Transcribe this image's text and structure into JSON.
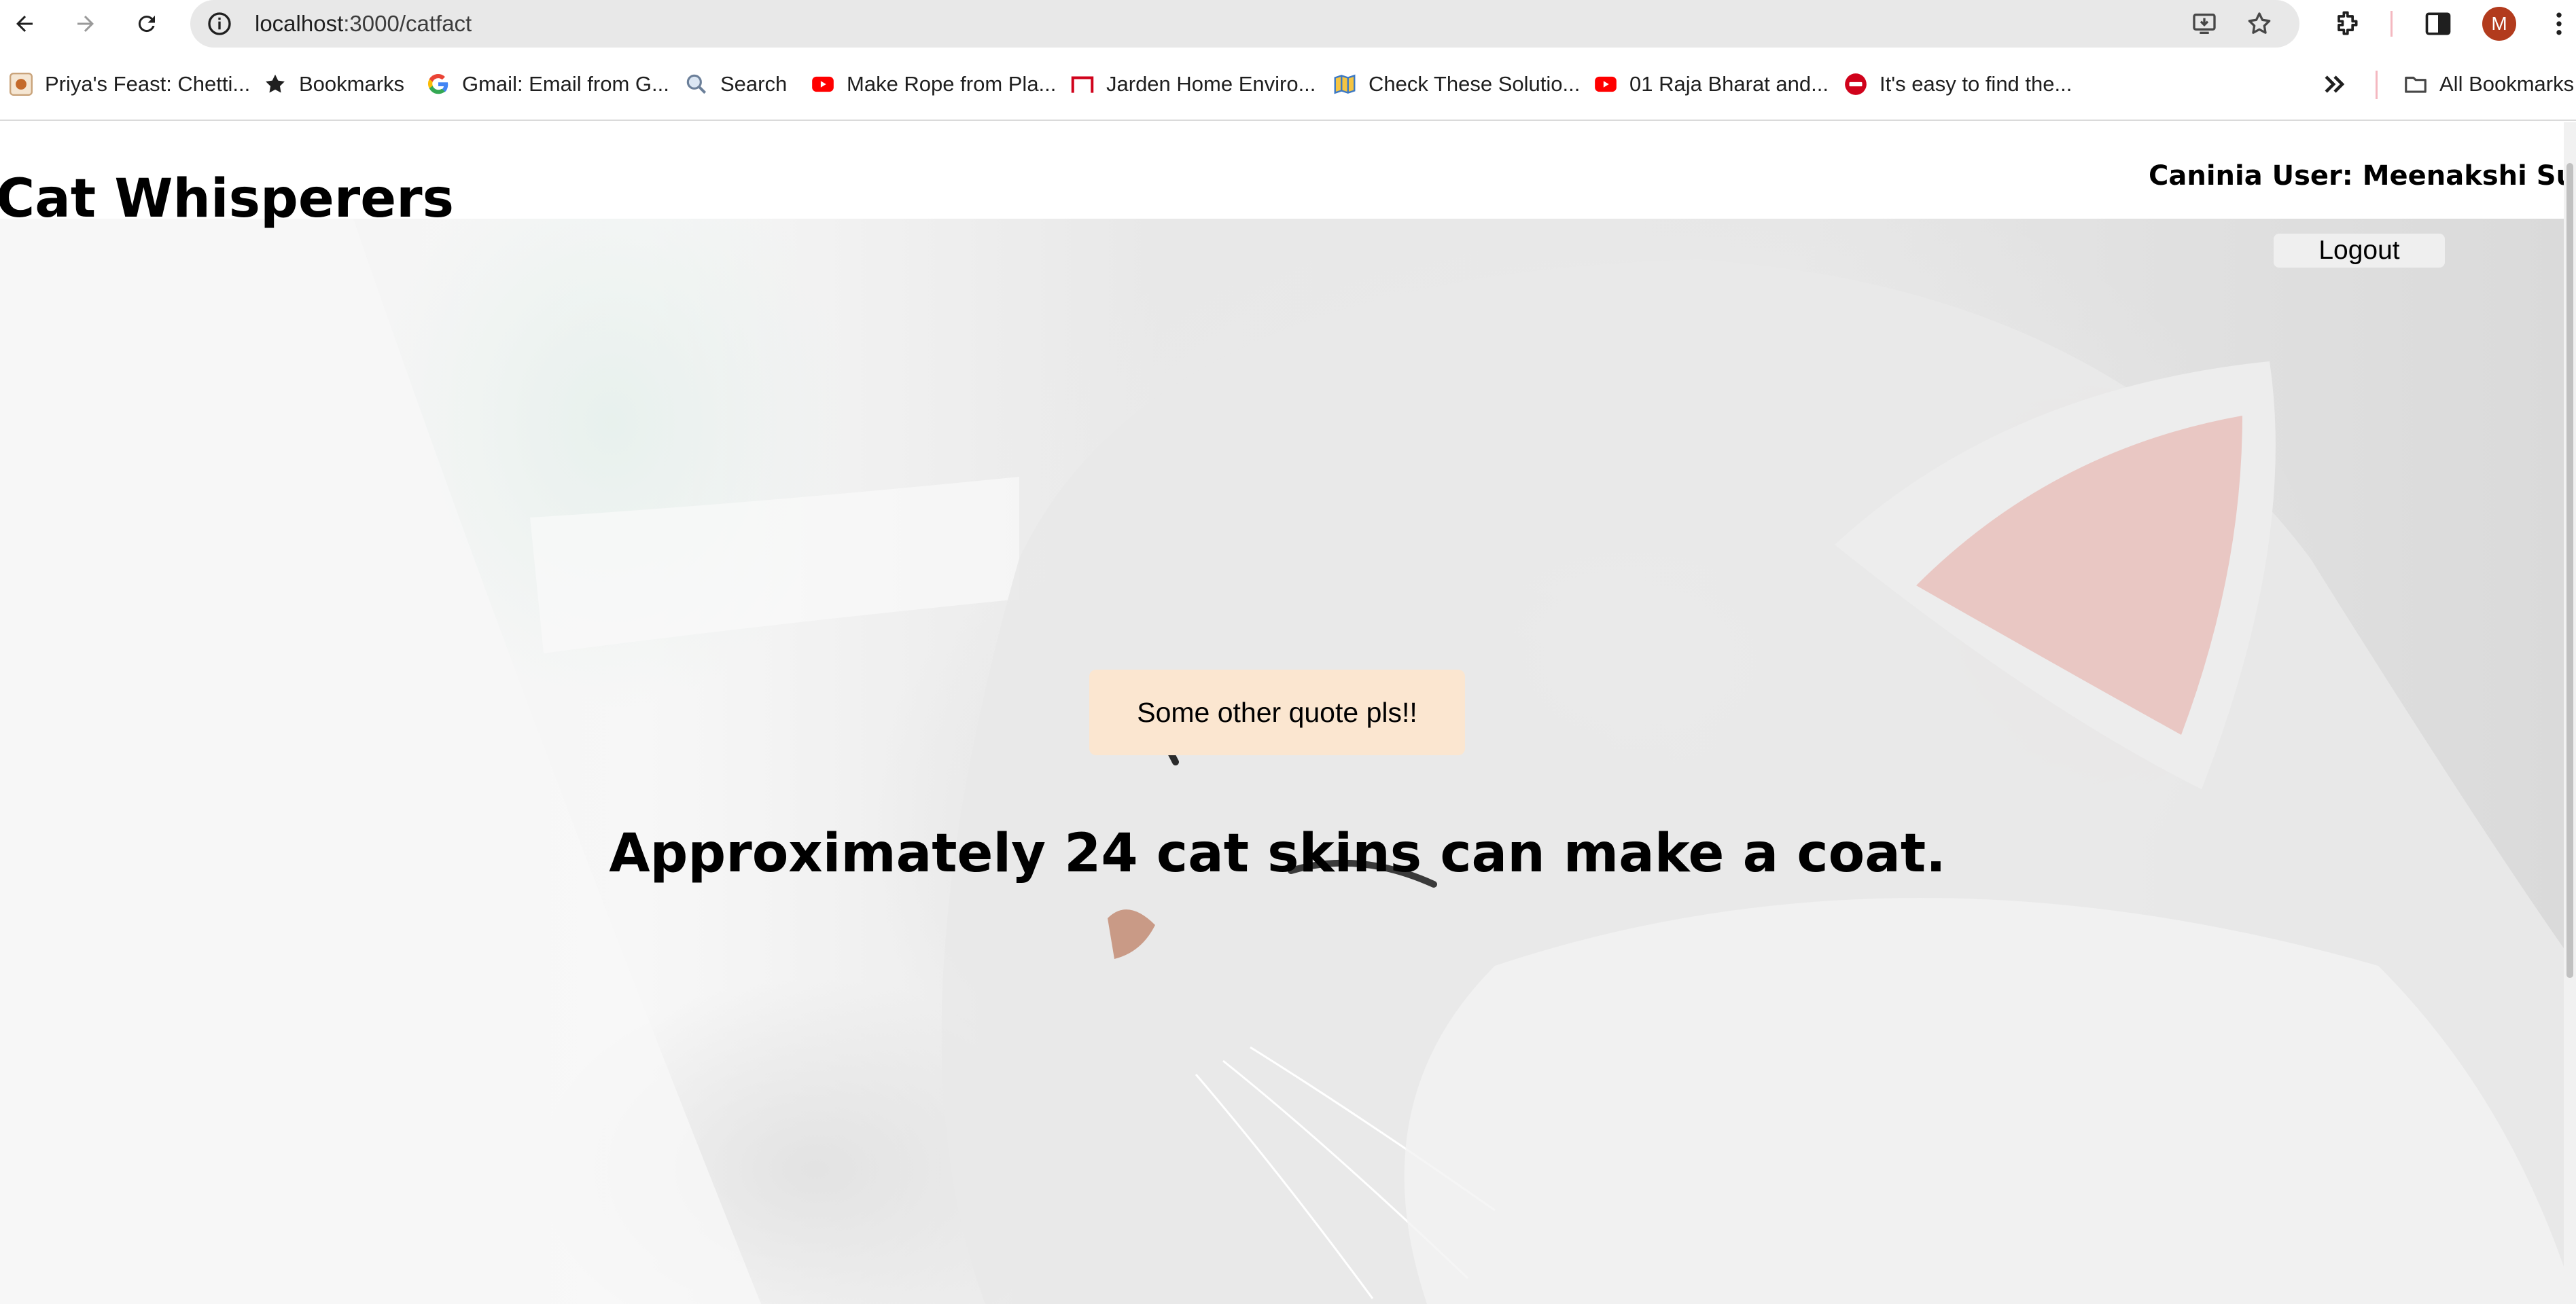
{
  "browser": {
    "url_host": "localhost",
    "url_path": ":3000/catfact",
    "avatar_initial": "M",
    "bookmarks": [
      {
        "label": "Priya's Feast: Chetti...",
        "icon": "priyas-feast-favicon"
      },
      {
        "label": "Bookmarks",
        "icon": "star-icon"
      },
      {
        "label": "Gmail: Email from G...",
        "icon": "google-icon"
      },
      {
        "label": "Search",
        "icon": "search-icon"
      },
      {
        "label": "Make Rope from Pla...",
        "icon": "youtube-icon"
      },
      {
        "label": "Jarden Home Enviro...",
        "icon": "jarden-icon"
      },
      {
        "label": "Check These Solutio...",
        "icon": "solutions-icon"
      },
      {
        "label": "01 Raja Bharat and...",
        "icon": "youtube-icon"
      },
      {
        "label": "It's easy to find the...",
        "icon": "red-circle-icon"
      }
    ],
    "all_bookmarks_label": "All Bookmarks"
  },
  "page": {
    "site_title": "Cat Whisperers",
    "user_label": "Caninia User: Meenakshi Sundari",
    "logout_label": "Logout",
    "quote_button_label": "Some other quote pls!!",
    "cat_fact": "Approximately 24 cat skins can make a coat."
  },
  "colors": {
    "quote_button_bg": "#fbe6d0",
    "logout_button_bg": "#efefef",
    "avatar_bg": "#b23b1d",
    "omnibox_bg": "#e8e8e8"
  }
}
